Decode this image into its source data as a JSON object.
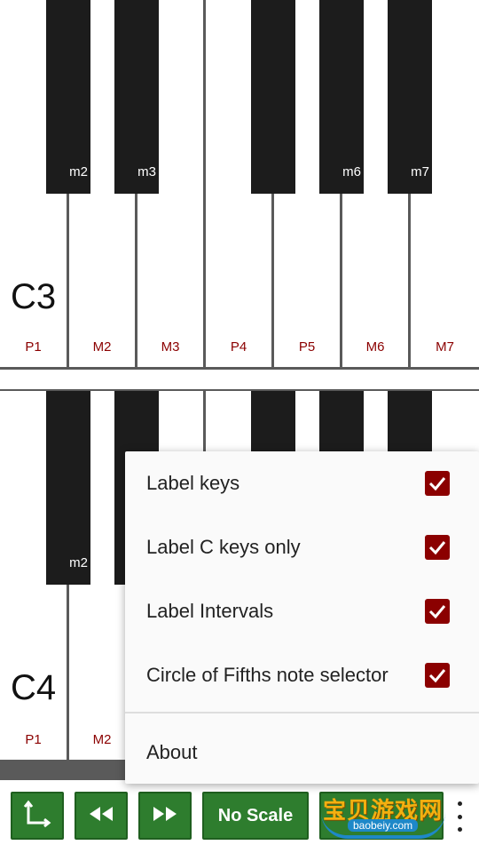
{
  "keyboard_top": {
    "octave_label": "C3",
    "white_intervals": [
      "P1",
      "M2",
      "M3",
      "P4",
      "P5",
      "M6",
      "M7"
    ],
    "black_intervals": [
      "m2",
      "m3",
      "m6",
      "m7"
    ]
  },
  "keyboard_bottom": {
    "octave_label": "C4",
    "white_intervals": [
      "P1",
      "M2"
    ],
    "black_intervals": [
      "m2"
    ]
  },
  "menu": {
    "items": [
      {
        "label": "Label keys",
        "checked": true
      },
      {
        "label": "Label C keys only",
        "checked": true
      },
      {
        "label": "Label Intervals",
        "checked": true
      },
      {
        "label": "Circle of Fifths note selector",
        "checked": true
      }
    ],
    "about_label": "About"
  },
  "toolbar": {
    "axis_icon": "axis-icon",
    "rewind_icon": "rewind-icon",
    "forward_icon": "fast-forward-icon",
    "scale_label": "No Scale",
    "overflow_icon": "more-vert-icon"
  },
  "watermark": {
    "text": "宝贝游戏网",
    "sub": "baobeiy.com"
  },
  "colors": {
    "accent": "#2e7d2e",
    "checkbox": "#8b0000",
    "interval_text": "#8b0000",
    "black_key": "#1c1c1c"
  }
}
